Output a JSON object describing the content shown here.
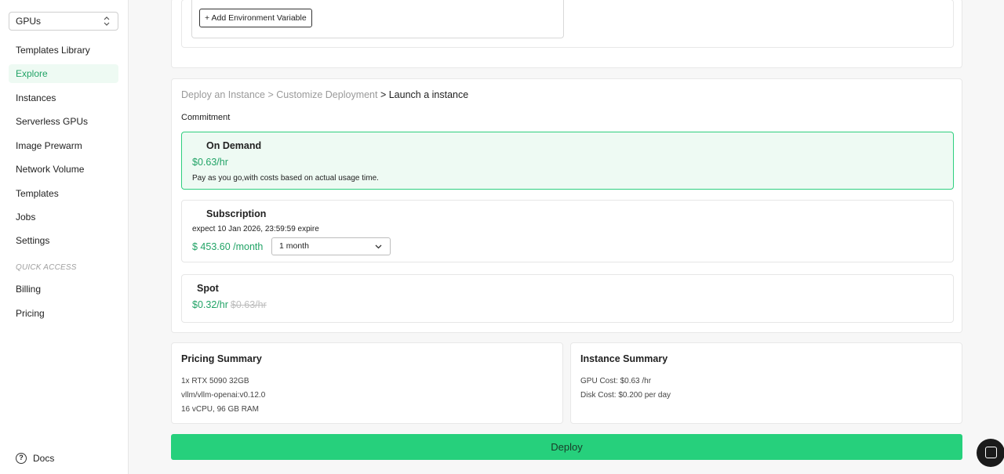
{
  "sidebar": {
    "selector": "GPUs",
    "items": [
      {
        "label": "Templates Library"
      },
      {
        "label": "Explore"
      },
      {
        "label": "Instances"
      },
      {
        "label": "Serverless GPUs"
      },
      {
        "label": "Image Prewarm"
      },
      {
        "label": "Network Volume"
      },
      {
        "label": "Templates"
      },
      {
        "label": "Jobs"
      },
      {
        "label": "Settings"
      }
    ],
    "quick_access_label": "QUICK ACCESS",
    "quick_items": [
      {
        "label": "Billing"
      },
      {
        "label": "Pricing"
      }
    ],
    "docs_label": "Docs"
  },
  "env": {
    "add_button": "+ Add Environment Variable"
  },
  "deploy": {
    "breadcrumb_1": "Deploy an Instance",
    "sep_1": " > ",
    "breadcrumb_2": "Customize Deployment",
    "sep_2": " > ",
    "breadcrumb_3": "Launch a instance",
    "commitment_label": "Commitment",
    "on_demand": {
      "title": "On Demand",
      "price": "$0.63/hr",
      "description": "Pay as you go,with costs based on actual usage time."
    },
    "subscription": {
      "title": "Subscription",
      "expire": "expect  10 Jan 2026, 23:59:59 expire",
      "price": "$ 453.60 /month",
      "duration": "1 month"
    },
    "spot": {
      "title": "Spot",
      "price": "$0.32/hr",
      "original_price": "$0.63/hr"
    }
  },
  "pricing_summary": {
    "title": "Pricing Summary",
    "lines": [
      "1x RTX 5090 32GB",
      "vllm/vllm-openai:v0.12.0",
      "16 vCPU, 96 GB RAM"
    ]
  },
  "instance_summary": {
    "title": "Instance Summary",
    "gpu_cost": "GPU Cost: $0.63 /hr",
    "disk_cost": "Disk Cost: $0.200 per day"
  },
  "deploy_button": "Deploy",
  "colors": {
    "accent": "#26d07c",
    "price_green": "#21a366",
    "selected_bg": "#eefaf3"
  }
}
